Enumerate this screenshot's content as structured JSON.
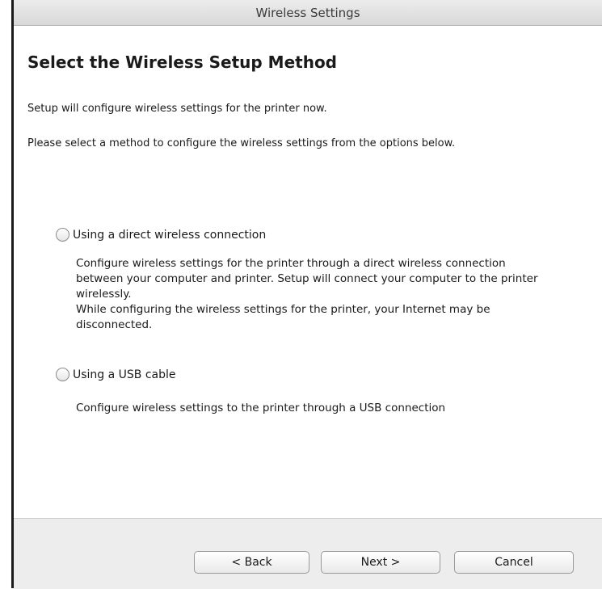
{
  "window": {
    "title": "Wireless Settings"
  },
  "main": {
    "heading": "Select the Wireless Setup Method",
    "intro_line1": "Setup will configure wireless settings for the printer now.",
    "intro_line2": "Please select a method to configure the wireless settings from the options below.",
    "options": [
      {
        "label": "Using a direct wireless connection",
        "selected": false,
        "description_lines": [
          "Configure wireless settings for the printer through a direct wireless connection",
          "between your computer and printer. Setup will connect your computer to the printer",
          "wirelessly.",
          "While configuring the wireless settings for the printer, your Internet may be",
          "disconnected."
        ]
      },
      {
        "label": "Using a USB cable",
        "selected": false,
        "description_lines": [
          "Configure wireless settings to the printer through a USB connection"
        ]
      }
    ]
  },
  "footer": {
    "back_label": "< Back",
    "next_label": "Next >",
    "cancel_label": "Cancel"
  }
}
